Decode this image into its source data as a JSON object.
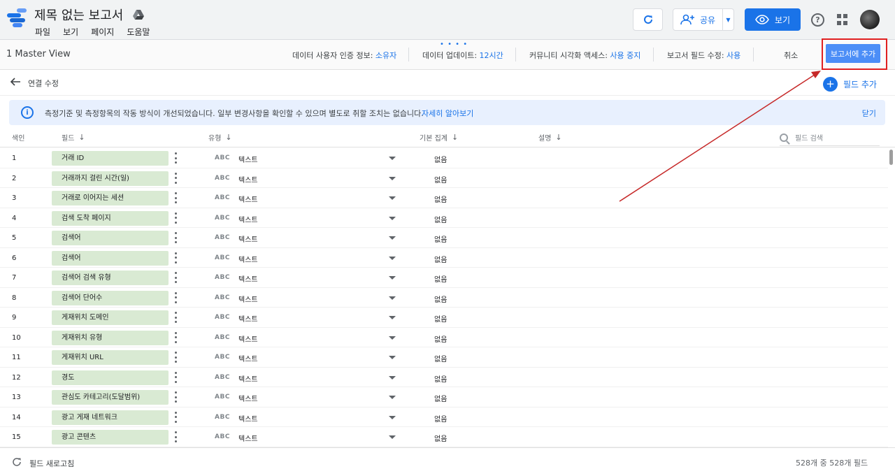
{
  "app": {
    "doc_title": "제목 없는 보고서",
    "menu": [
      "파일",
      "보기",
      "페이지",
      "도움말"
    ],
    "share_label": "공유",
    "view_label": "보기",
    "help_glyph": "?",
    "brand_color": "#1a73e8"
  },
  "subbar": {
    "view_name": "1 Master View",
    "credentials_label": "데이터 사용자 인증 정보: ",
    "credentials_value": "소유자",
    "freshness_label": "데이터 업데이트: ",
    "freshness_value": "12시간",
    "community_label": "커뮤니티 시각화 액세스: ",
    "community_value": "사용 중지",
    "field_edit_label": "보고서 필드 수정: ",
    "field_edit_value": "사용",
    "cancel_label": "취소",
    "add_to_report_label": "보고서에 추가"
  },
  "editor": {
    "edit_connection_label": "연결 수정",
    "add_field_label": "필드 추가"
  },
  "notice": {
    "icon": "i",
    "text": "측정기준 및 측정항목의 작동 방식이 개선되었습니다. 일부 변경사항을 확인할 수 있으며 별도로 취할 조치는 없습니다.",
    "link": "자세히 알아보기",
    "close": "닫기"
  },
  "table": {
    "headers": {
      "index": "색인",
      "field": "필드",
      "type": "유형",
      "aggregation": "기본 집계",
      "description": "설명"
    },
    "search_placeholder": "필드 검색",
    "rows": [
      {
        "index": "1",
        "field": "거래 ID",
        "type_icon": "ABC",
        "type": "텍스트",
        "aggregation": "없음"
      },
      {
        "index": "2",
        "field": "거래까지 걸린 시간(일)",
        "type_icon": "ABC",
        "type": "텍스트",
        "aggregation": "없음"
      },
      {
        "index": "3",
        "field": "거래로 이어지는 세션",
        "type_icon": "ABC",
        "type": "텍스트",
        "aggregation": "없음"
      },
      {
        "index": "4",
        "field": "검색 도착 페이지",
        "type_icon": "ABC",
        "type": "텍스트",
        "aggregation": "없음"
      },
      {
        "index": "5",
        "field": "검색어",
        "type_icon": "ABC",
        "type": "텍스트",
        "aggregation": "없음"
      },
      {
        "index": "6",
        "field": "검색어",
        "type_icon": "ABC",
        "type": "텍스트",
        "aggregation": "없음"
      },
      {
        "index": "7",
        "field": "검색어 검색 유형",
        "type_icon": "ABC",
        "type": "텍스트",
        "aggregation": "없음"
      },
      {
        "index": "8",
        "field": "검색어 단어수",
        "type_icon": "ABC",
        "type": "텍스트",
        "aggregation": "없음"
      },
      {
        "index": "9",
        "field": "게재위치 도메인",
        "type_icon": "ABC",
        "type": "텍스트",
        "aggregation": "없음"
      },
      {
        "index": "10",
        "field": "게재위치 유형",
        "type_icon": "ABC",
        "type": "텍스트",
        "aggregation": "없음"
      },
      {
        "index": "11",
        "field": "게재위치 URL",
        "type_icon": "ABC",
        "type": "텍스트",
        "aggregation": "없음"
      },
      {
        "index": "12",
        "field": "경도",
        "type_icon": "ABC",
        "type": "텍스트",
        "aggregation": "없음"
      },
      {
        "index": "13",
        "field": "관심도 카테고리(도달범위)",
        "type_icon": "ABC",
        "type": "텍스트",
        "aggregation": "없음"
      },
      {
        "index": "14",
        "field": "광고 게재 네트워크",
        "type_icon": "ABC",
        "type": "텍스트",
        "aggregation": "없음"
      },
      {
        "index": "15",
        "field": "광고 콘텐츠",
        "type_icon": "ABC",
        "type": "텍스트",
        "aggregation": "없음"
      }
    ]
  },
  "footer": {
    "refresh_label": "필드 새로고침",
    "count_text": "528개 중 528개 필드"
  },
  "annotation": {
    "highlight_color": "#e02020",
    "arrow_color": "#c62828"
  }
}
